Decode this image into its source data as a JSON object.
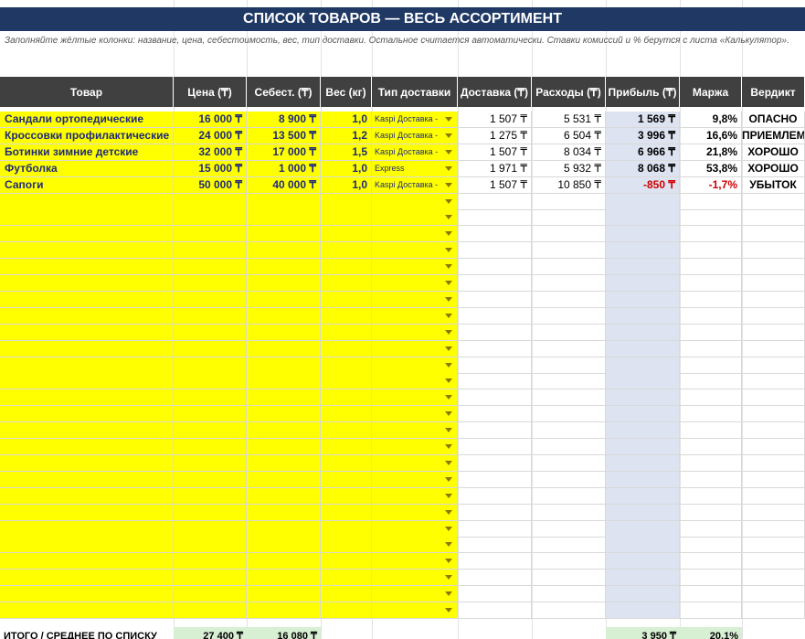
{
  "title": "СПИСОК ТОВАРОВ — ВЕСЬ АССОРТИМЕНТ",
  "hint": "Заполняйте жёлтые колонки: название, цена, себестоимость, вес, тип доставки. Остальное считается автоматически. Ставки комиссий и % берутся с листа «Калькулятор».",
  "headers": [
    "Товар",
    "Цена (₸)",
    "Себест. (₸)",
    "Вес (кг)",
    "Тип доставки",
    "Доставка (₸)",
    "Расходы (₸)",
    "Прибыль (₸)",
    "Маржа",
    "Вердикт"
  ],
  "rows": [
    {
      "name": "Сандали ортопедические",
      "price": "16 000 ₸",
      "cost": "8 900 ₸",
      "weight": "1,0",
      "ship": "Kaspi Доставка -",
      "delivery": "1 507 ₸",
      "expenses": "5 531 ₸",
      "profit": "1 569 ₸",
      "margin": "9,8%",
      "verdict": "ОПАСНО"
    },
    {
      "name": "Кроссовки профилактические",
      "price": "24 000 ₸",
      "cost": "13 500 ₸",
      "weight": "1,2",
      "ship": "Kaspi Доставка -",
      "delivery": "1 275 ₸",
      "expenses": "6 504 ₸",
      "profit": "3 996 ₸",
      "margin": "16,6%",
      "verdict": "ПРИЕМЛЕМ"
    },
    {
      "name": "Ботинки зимние детские",
      "price": "32 000 ₸",
      "cost": "17 000 ₸",
      "weight": "1,5",
      "ship": "Kaspi Доставка -",
      "delivery": "1 507 ₸",
      "expenses": "8 034 ₸",
      "profit": "6 966 ₸",
      "margin": "21,8%",
      "verdict": "ХОРОШО"
    },
    {
      "name": "Футболка",
      "price": "15 000 ₸",
      "cost": "1 000 ₸",
      "weight": "1,0",
      "ship": "Express",
      "delivery": "1 971 ₸",
      "expenses": "5 932 ₸",
      "profit": "8 068 ₸",
      "margin": "53,8%",
      "verdict": "ХОРОШО"
    },
    {
      "name": "Сапоги",
      "price": "50 000 ₸",
      "cost": "40 000 ₸",
      "weight": "1,0",
      "ship": "Kaspi Доставка -",
      "delivery": "1 507 ₸",
      "expenses": "10 850 ₸",
      "profit": "-850 ₸",
      "margin": "-1,7%",
      "verdict": "УБЫТОК"
    }
  ],
  "totals": {
    "label": "ИТОГО / СРЕДНЕЕ ПО СПИСКУ",
    "price": "27 400 ₸",
    "cost": "16 080 ₸",
    "profit": "3 950 ₸",
    "margin": "20,1%"
  },
  "colors": {
    "title_bg": "#1f3864",
    "header_bg": "#404040",
    "input_yellow": "#ffff00",
    "profit_bg": "#dde3f0",
    "negative": "#d00000",
    "name_text": "#1f2a7a"
  }
}
